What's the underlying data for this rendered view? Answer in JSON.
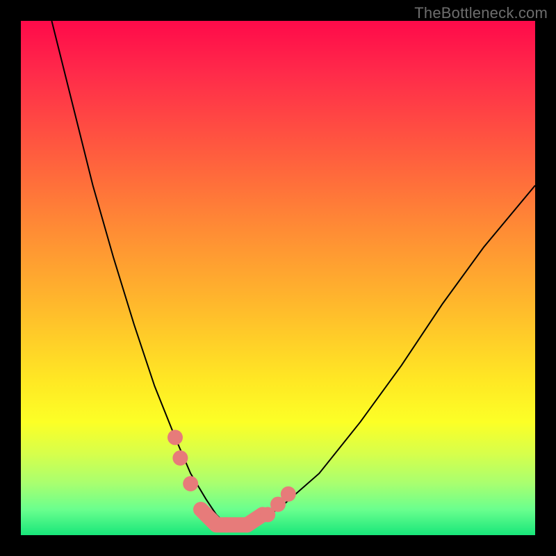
{
  "watermark": "TheBottleneck.com",
  "chart_data": {
    "type": "line",
    "title": "",
    "xlabel": "",
    "ylabel": "",
    "xlim": [
      0,
      100
    ],
    "ylim": [
      0,
      100
    ],
    "grid": false,
    "series": [
      {
        "name": "bottleneck-curve",
        "x": [
          6,
          10,
          14,
          18,
          22,
          26,
          30,
          33,
          36,
          38,
          40,
          44,
          50,
          58,
          66,
          74,
          82,
          90,
          100
        ],
        "y": [
          100,
          84,
          68,
          54,
          41,
          29,
          19,
          12,
          7,
          4,
          2,
          2,
          5,
          12,
          22,
          33,
          45,
          56,
          68
        ]
      }
    ],
    "highlight_points": [
      {
        "x": 30,
        "y": 19
      },
      {
        "x": 31,
        "y": 15
      },
      {
        "x": 33,
        "y": 10
      },
      {
        "x": 36,
        "y": 4
      },
      {
        "x": 40,
        "y": 2
      },
      {
        "x": 44,
        "y": 2
      },
      {
        "x": 48,
        "y": 4
      },
      {
        "x": 50,
        "y": 6
      },
      {
        "x": 52,
        "y": 8
      }
    ],
    "basin_path": [
      {
        "x": 35,
        "y": 5
      },
      {
        "x": 38,
        "y": 2
      },
      {
        "x": 44,
        "y": 2
      },
      {
        "x": 47,
        "y": 4
      }
    ],
    "colors": {
      "curve": "#000000",
      "highlight": "#e77b7a",
      "gradient_top": "#ff0a4a",
      "gradient_bottom": "#18e67a"
    }
  }
}
